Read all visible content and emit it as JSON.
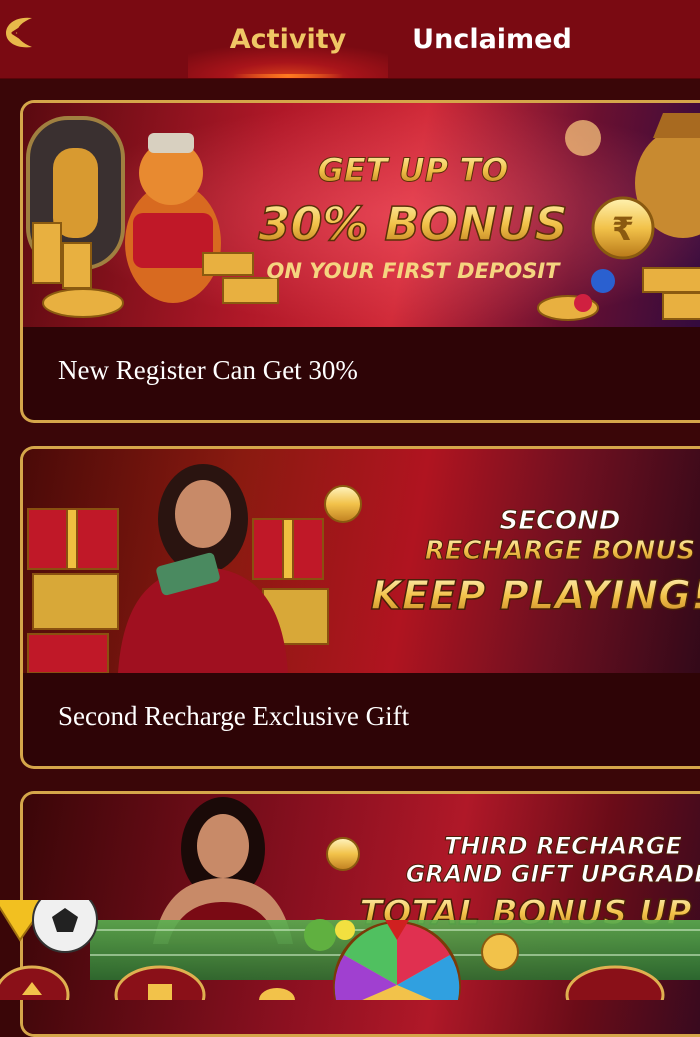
{
  "header": {
    "back_icon": "crescent-back-icon",
    "tabs": [
      {
        "label": "Activity",
        "active": true
      },
      {
        "label": "Unclaimed",
        "active": false
      }
    ]
  },
  "cards": [
    {
      "banner": {
        "line1": "GET UP TO",
        "line2": "30% BONUS",
        "line3": "ON YOUR FIRST DEPOSIT"
      },
      "title": "New Register Can Get 30%"
    },
    {
      "banner": {
        "line1": "SECOND",
        "line2": "RECHARGE BONUS",
        "line3": "KEEP PLAYING!"
      },
      "title": "Second Recharge Exclusive Gift"
    },
    {
      "banner": {
        "line1": "THIRD RECHARGE",
        "line2": "GRAND GIFT UPGRADE:",
        "line3": "TOTAL BONUS UP T"
      }
    }
  ],
  "colors": {
    "header_bg": "#7a0a12",
    "page_bg": "#3a0608",
    "card_border": "#d5a64a",
    "active_tab": "#f0c765",
    "inactive_tab": "#ffffff"
  }
}
